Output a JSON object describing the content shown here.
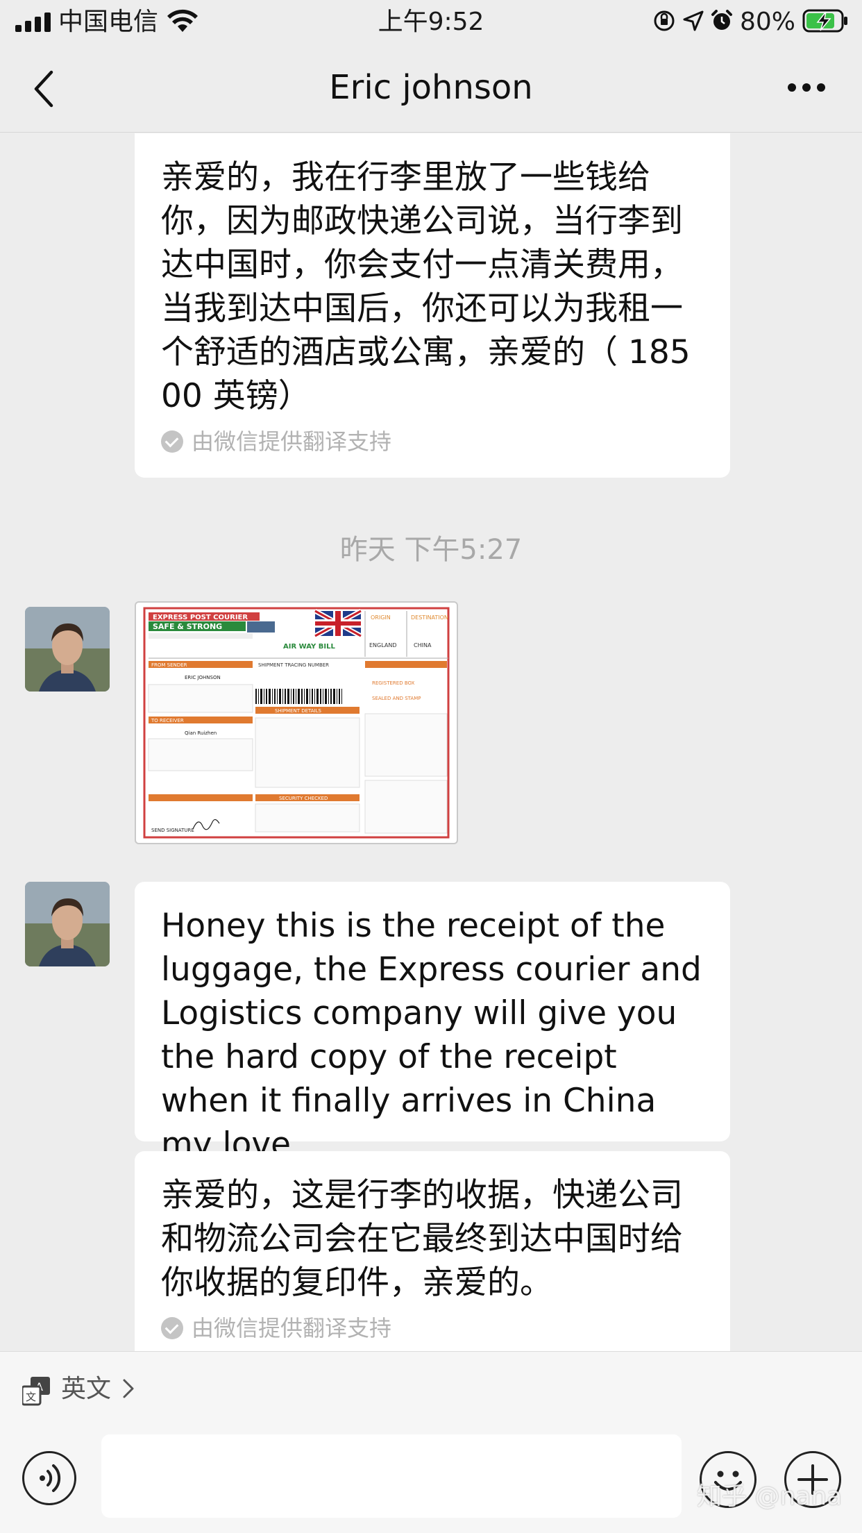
{
  "status_bar": {
    "carrier": "中国电信",
    "time": "上午9:52",
    "battery_percent": "80%"
  },
  "nav": {
    "title": "Eric johnson"
  },
  "messages": {
    "m1": {
      "text": "亲爱的，我在行李里放了一些钱给你，因为邮政快递公司说，当行李到达中国时，你会支付一点清关费用，当我到达中国后，你还可以为我租一个舒适的酒店或公寓，亲爱的（ 18500 英镑）",
      "credit": "由微信提供翻译支持"
    },
    "timestamp": "昨天 下午5:27",
    "m2": {
      "type": "image",
      "header_brand": "EXPRESS POST COURIER",
      "header_slogan": "SAFE & STRONG",
      "doc_title": "AIR WAY BILL",
      "origin_label": "ORIGIN",
      "destination_label": "DESTINATION",
      "origin": "ENGLAND",
      "destination": "CHINA",
      "from_sender": "FROM SENDER",
      "sender_name": "ERIC JOHNSON",
      "to_receiver": "TO RECEIVER",
      "receiver_name": "Qian Ruizhen",
      "shipment_details": "SHIPMENT DETAILS",
      "tracking_label": "SHIPMENT TRACING NUMBER",
      "security_checked": "SECURITY CHECKED",
      "registered_box": "REGISTERED BOX",
      "sealed": "SEALED AND STAMP",
      "send_signature": "SEND SIGNATURE"
    },
    "m3": {
      "text": "Honey this is the receipt of the luggage, the Express courier and Logistics company will give you the hard copy of the receipt when it finally arrives in China my love"
    },
    "m4": {
      "text": "亲爱的，这是行李的收据，快递公司和物流公司会在它最终到达中国时给你收据的复印件，亲爱的。",
      "credit": "由微信提供翻译支持"
    }
  },
  "translate_bar": {
    "label": "英文"
  },
  "watermark": "知乎 @nana"
}
